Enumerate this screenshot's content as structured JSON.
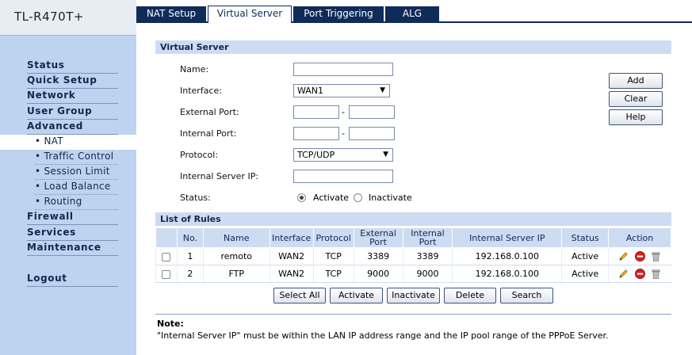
{
  "brand": "TL-R470T+",
  "sidebar": {
    "items": [
      {
        "label": "Status",
        "type": "main"
      },
      {
        "label": "Quick Setup",
        "type": "main"
      },
      {
        "label": "Network",
        "type": "main"
      },
      {
        "label": "User Group",
        "type": "main"
      },
      {
        "label": "Advanced",
        "type": "main"
      },
      {
        "label": "• NAT",
        "type": "sub",
        "active": true
      },
      {
        "label": "• Traffic Control",
        "type": "sub"
      },
      {
        "label": "• Session Limit",
        "type": "sub"
      },
      {
        "label": "• Load Balance",
        "type": "sub"
      },
      {
        "label": "• Routing",
        "type": "sub"
      },
      {
        "label": "Firewall",
        "type": "main"
      },
      {
        "label": "Services",
        "type": "main"
      },
      {
        "label": "Maintenance",
        "type": "main"
      },
      {
        "label": "Logout",
        "type": "main"
      }
    ]
  },
  "tabs": [
    {
      "label": "NAT Setup",
      "active": false
    },
    {
      "label": "Virtual Server",
      "active": true
    },
    {
      "label": "Port Triggering",
      "active": false
    },
    {
      "label": "ALG",
      "active": false
    }
  ],
  "virtual_server": {
    "title": "Virtual Server",
    "name_label": "Name:",
    "name_value": "",
    "interface_label": "Interface:",
    "interface_value": "WAN1",
    "external_port_label": "External Port:",
    "internal_port_label": "Internal Port:",
    "port_separator": "-",
    "protocol_label": "Protocol:",
    "protocol_value": "TCP/UDP",
    "internal_ip_label": "Internal Server IP:",
    "status_label": "Status:",
    "status_activate": "Activate",
    "status_inactivate": "Inactivate",
    "status_selected": "Activate",
    "add_label": "Add",
    "clear_label": "Clear",
    "help_label": "Help"
  },
  "rules": {
    "title": "List of Rules",
    "headers": [
      "",
      "No.",
      "Name",
      "Interface",
      "Protocol",
      "External Port",
      "Internal Port",
      "Internal Server IP",
      "Status",
      "Action"
    ],
    "rows": [
      {
        "no": "1",
        "name": "remoto",
        "interface": "WAN2",
        "protocol": "TCP",
        "external_port": "3389",
        "internal_port": "3389",
        "ip": "192.168.0.100",
        "status": "Active"
      },
      {
        "no": "2",
        "name": "FTP",
        "interface": "WAN2",
        "protocol": "TCP",
        "external_port": "9000",
        "internal_port": "9000",
        "ip": "192.168.0.100",
        "status": "Active"
      }
    ],
    "buttons": {
      "select_all": "Select All",
      "activate": "Activate",
      "inactivate": "Inactivate",
      "delete": "Delete",
      "search": "Search"
    }
  },
  "note": {
    "title": "Note:",
    "text": "\"Internal Server IP\" must be within the LAN IP address range and the IP pool range of the PPPoE Server."
  },
  "colors": {
    "sidebar_bg": "#bed3ef",
    "tab_dark": "#0f2b59",
    "section_bg": "#cddcf3",
    "edit_icon": "#e8a21a",
    "remove_icon": "#d81e1e"
  }
}
